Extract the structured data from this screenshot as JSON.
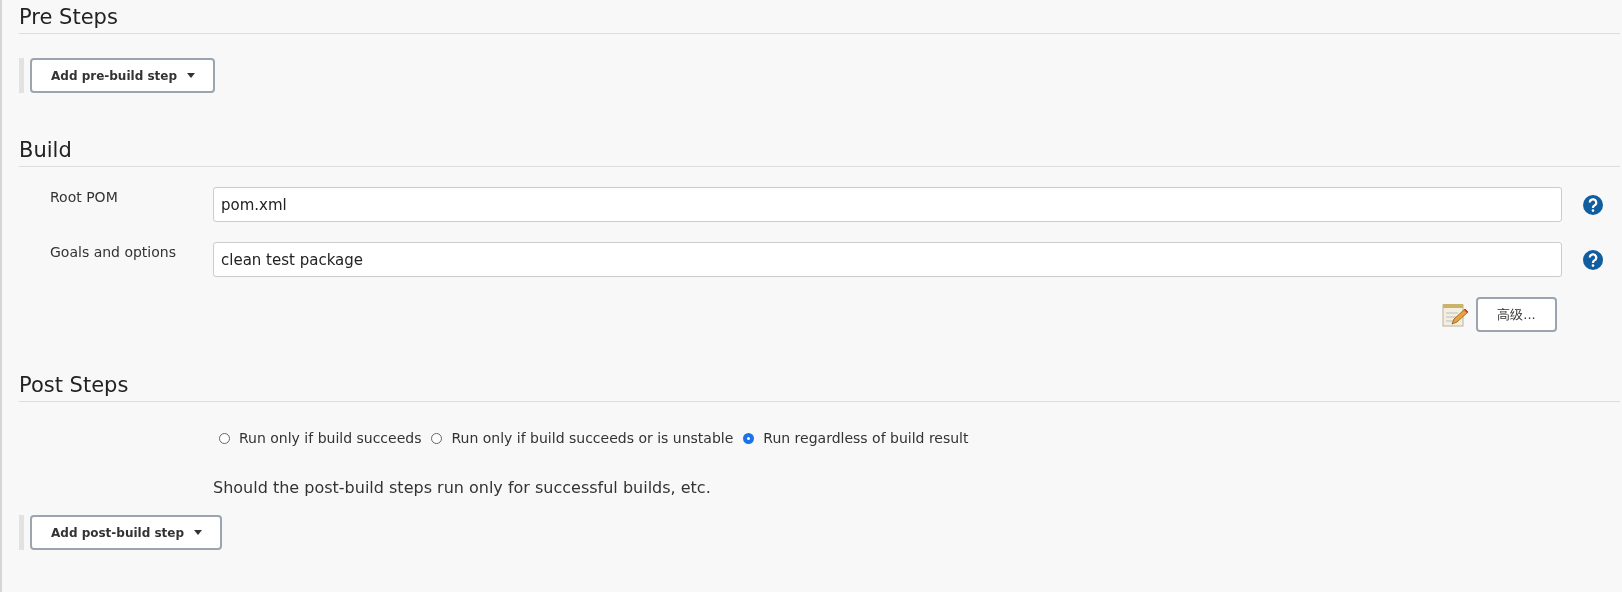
{
  "sections": [
    {
      "kind": "pre",
      "title": "Pre Steps",
      "add_button": "Add pre-build step"
    },
    {
      "kind": "build",
      "title": "Build",
      "fields": [
        {
          "label": "Root POM",
          "value": "pom.xml"
        },
        {
          "label": "Goals and options",
          "value": "clean test package"
        }
      ],
      "advanced_button": "高级..."
    },
    {
      "kind": "post",
      "title": "Post Steps",
      "options": [
        {
          "label": "Run only if build succeeds",
          "selected": false
        },
        {
          "label": "Run only if build succeeds or is unstable",
          "selected": false
        },
        {
          "label": "Run regardless of build result",
          "selected": true
        }
      ],
      "description": "Should the post-build steps run only for successful builds, etc.",
      "add_button": "Add post-build step"
    }
  ]
}
